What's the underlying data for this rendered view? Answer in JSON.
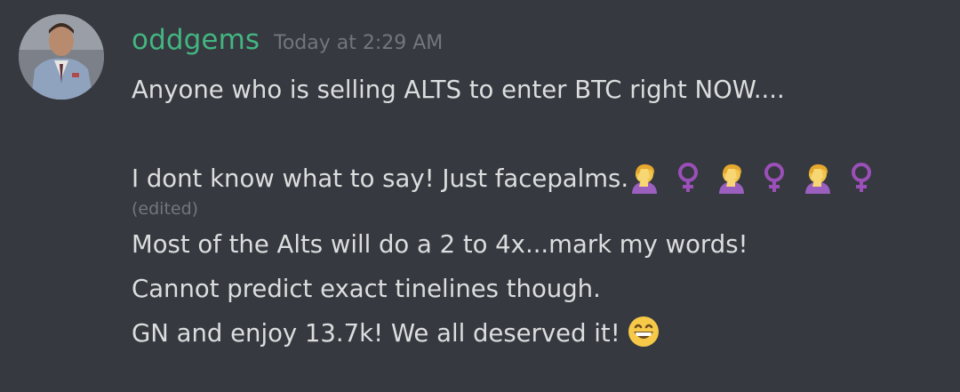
{
  "message": {
    "author": {
      "username": "oddgems",
      "username_color": "#43b581",
      "avatar_icon": "avatar-icon"
    },
    "timestamp": "Today at 2:29 AM",
    "lines": [
      "Anyone who is selling ALTS to enter BTC right NOW....",
      "I dont know what to say! Just facepalms.",
      "Most of the Alts will do a 2 to 4x...mark my words!",
      "Cannot predict exact tinelines though.",
      "GN and enjoy 13.7k! We all deserved it!"
    ],
    "edited_label": "(edited)",
    "emojis": {
      "facepalm": "person-facepalming-icon",
      "female_sign": "female-sign-icon",
      "grin": "grinning-face-icon"
    }
  },
  "theme": {
    "background": "#36393f",
    "text": "#dcddde",
    "muted": "#72767d"
  }
}
